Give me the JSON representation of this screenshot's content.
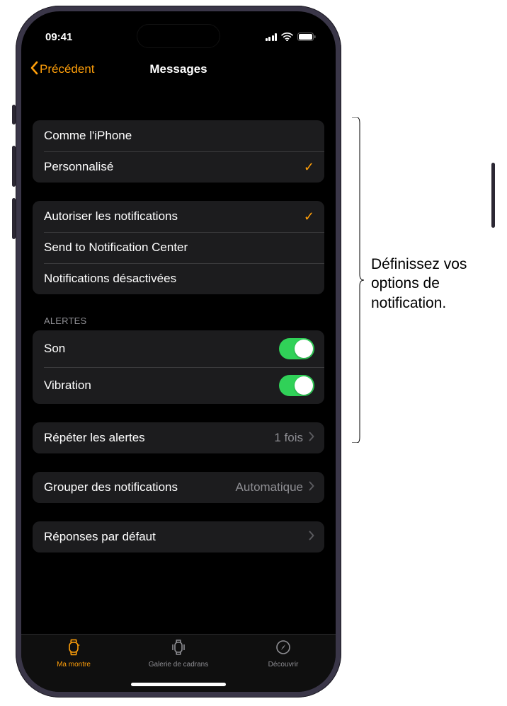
{
  "status": {
    "time": "09:41"
  },
  "nav": {
    "back": "Précédent",
    "title": "Messages"
  },
  "groups": {
    "mirror": {
      "items": [
        {
          "label": "Comme l'iPhone",
          "checked": false
        },
        {
          "label": "Personnalisé",
          "checked": true
        }
      ]
    },
    "allow": {
      "items": [
        {
          "label": "Autoriser les notifications",
          "checked": true
        },
        {
          "label": "Send to Notification Center",
          "checked": false
        },
        {
          "label": "Notifications désactivées",
          "checked": false
        }
      ]
    },
    "alerts": {
      "header": "ALERTES",
      "items": [
        {
          "label": "Son",
          "on": true
        },
        {
          "label": "Vibration",
          "on": true
        }
      ]
    },
    "repeat": {
      "label": "Répéter les alertes",
      "value": "1 fois"
    },
    "grouping": {
      "label": "Grouper des notifications",
      "value": "Automatique"
    },
    "defaultReplies": {
      "label": "Réponses par défaut"
    }
  },
  "tabs": {
    "mywatch": "Ma montre",
    "gallery": "Galerie de cadrans",
    "discover": "Découvrir"
  },
  "callout": "Définissez vos options de notification."
}
